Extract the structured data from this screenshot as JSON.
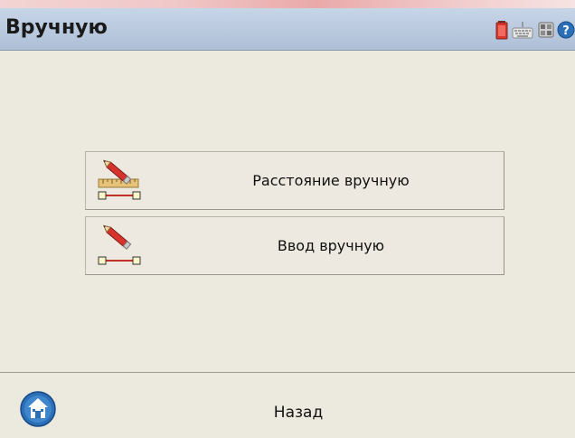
{
  "window": {
    "title": "Вручную"
  },
  "status_icons": [
    {
      "name": "battery-icon",
      "color": "#d9342b"
    },
    {
      "name": "keyboard-icon",
      "color": "#8a8a8a"
    },
    {
      "name": "system-icon",
      "color": "#6d6d6d"
    },
    {
      "name": "help-icon",
      "color": "#2a6fb8"
    }
  ],
  "menu": {
    "items": [
      {
        "label": "Расстояние вручную",
        "icon": "pencil-ruler-icon"
      },
      {
        "label": "Ввод вручную",
        "icon": "pencil-line-icon"
      }
    ]
  },
  "footer": {
    "back_label": "Назад",
    "home_icon": "home-icon"
  },
  "colors": {
    "background": "#ece9df",
    "title_bar": "#b8c7dd",
    "accent_blue": "#2a6fb8"
  }
}
